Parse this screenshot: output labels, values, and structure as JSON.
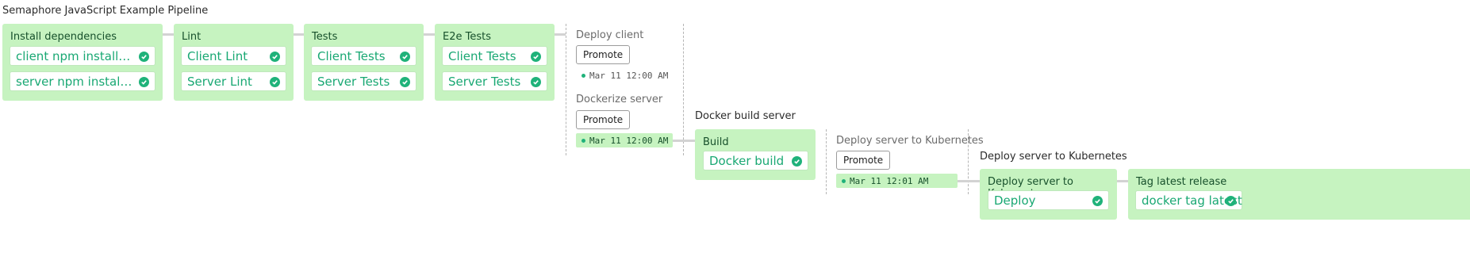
{
  "pipeline_title": "Semaphore JavaScript Example Pipeline",
  "blocks": {
    "install": {
      "name": "Install dependencies",
      "jobs": [
        "client npm install and …",
        "server npm install and …"
      ]
    },
    "lint": {
      "name": "Lint",
      "jobs": [
        "Client Lint",
        "Server Lint"
      ]
    },
    "tests": {
      "name": "Tests",
      "jobs": [
        "Client Tests",
        "Server Tests"
      ]
    },
    "e2e": {
      "name": "E2e Tests",
      "jobs": [
        "Client Tests",
        "Server Tests"
      ]
    },
    "build": {
      "name": "Build",
      "jobs": [
        "Docker build"
      ]
    },
    "deploy": {
      "name": "Deploy server to Kubernetes",
      "jobs": [
        "Deploy"
      ]
    },
    "tag": {
      "name": "Tag latest release",
      "jobs": [
        "docker tag latest"
      ]
    }
  },
  "promotions": {
    "deploy_client": {
      "label": "Deploy client",
      "button": "Promote",
      "time": "Mar 11 12:00 AM"
    },
    "dockerize_server": {
      "label": "Dockerize server",
      "button": "Promote",
      "time": "Mar 11 12:00 AM"
    },
    "deploy_k8s": {
      "label": "Deploy server to Kubernetes",
      "button": "Promote",
      "time": "Mar 11 12:01 AM"
    }
  },
  "pipelines": {
    "docker_build": "Docker build server",
    "deploy_k8s": "Deploy server to Kubernetes"
  },
  "colors": {
    "block_bg": "#c6f3c0",
    "passed": "#1fb27a",
    "job_text": "#19a873"
  },
  "icons": {
    "job_status": "check-circle-icon",
    "promotion_status": "status-dot-icon"
  }
}
